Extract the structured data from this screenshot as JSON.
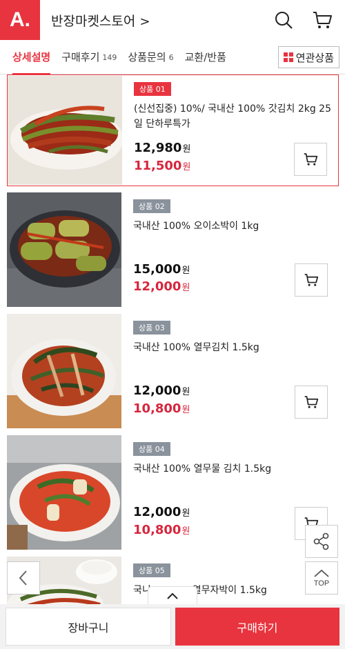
{
  "header": {
    "logo": "A.",
    "store_name": "반장마켓스토어",
    "chevron": ">"
  },
  "tabs": [
    {
      "label": "상세설명",
      "count": ""
    },
    {
      "label": "구매후기",
      "count": "149"
    },
    {
      "label": "상품문의",
      "count": "6"
    },
    {
      "label": "교환/반품",
      "count": ""
    }
  ],
  "related_label": "연관상품",
  "colors": {
    "accent": "#e8343f",
    "sale": "#d7263d",
    "badge_gray": "#8a929c"
  },
  "products": [
    {
      "badge": "상품 01",
      "name": "(신선집중) 10%/ 국내산 100% 갓김치 2kg 25일 단하루특가",
      "price": "12,980",
      "sale": "11,500",
      "unit": "원",
      "image": "mustard-leaf-kimchi-photo"
    },
    {
      "badge": "상품 02",
      "name": "국내산 100% 오이소박이 1kg",
      "price": "15,000",
      "sale": "12,000",
      "unit": "원",
      "image": "cucumber-kimchi-photo"
    },
    {
      "badge": "상품 03",
      "name": "국내산 100% 열무김치 1.5kg",
      "price": "12,000",
      "sale": "10,800",
      "unit": "원",
      "image": "young-radish-kimchi-photo"
    },
    {
      "badge": "상품 04",
      "name": "국내산 100% 열무물 김치 1.5kg",
      "price": "12,000",
      "sale": "10,800",
      "unit": "원",
      "image": "radish-water-kimchi-photo"
    },
    {
      "badge": "상품 05",
      "name_left": "국니",
      "name_right": "열무자박이 1.5kg",
      "image": "kimchi-rice-photo"
    }
  ],
  "float": {
    "top_label": "TOP"
  },
  "bottom": {
    "cart_label": "장바구니",
    "buy_label": "구매하기"
  }
}
